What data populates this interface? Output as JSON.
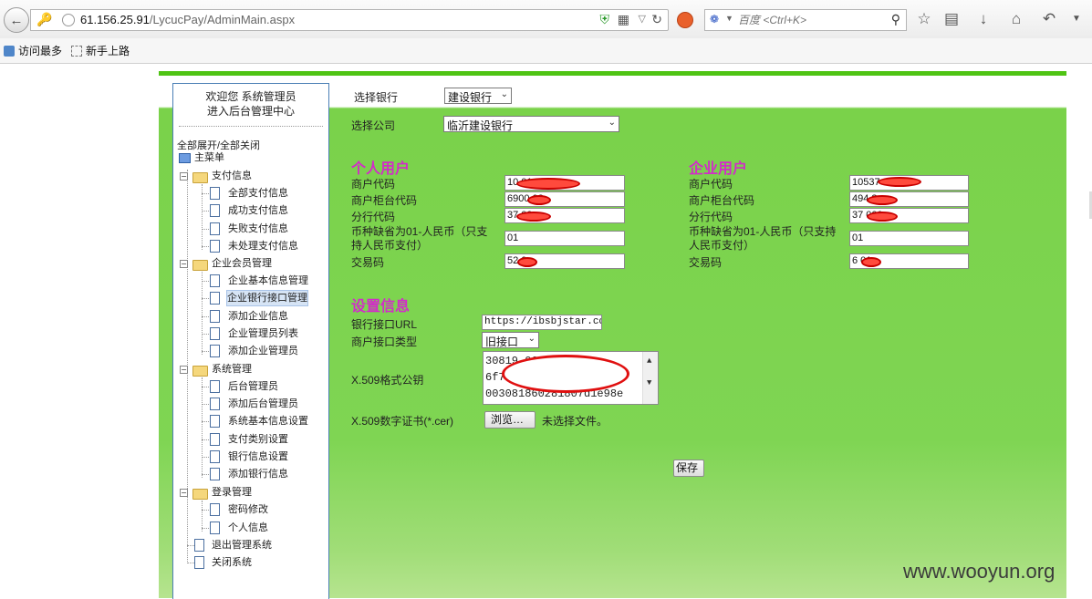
{
  "browser": {
    "url_host": "61.156.25.91",
    "url_path": "/LycucPay/AdminMain.aspx",
    "search_placeholder": "百度 <Ctrl+K>",
    "bookmarks": [
      "访问最多",
      "新手上路"
    ]
  },
  "sidebar": {
    "welcome_line1": "欢迎您  系统管理员",
    "welcome_line2": "进入后台管理中心",
    "toggle_all": "全部展开/全部关闭",
    "root": "主菜单",
    "groups": [
      {
        "label": "支付信息",
        "items": [
          "全部支付信息",
          "成功支付信息",
          "失败支付信息",
          "未处理支付信息"
        ]
      },
      {
        "label": "企业会员管理",
        "items": [
          "企业基本信息管理",
          "企业银行接口管理",
          "添加企业信息",
          "企业管理员列表",
          "添加企业管理员"
        ]
      },
      {
        "label": "系统管理",
        "items": [
          "后台管理员",
          "添加后台管理员",
          "系统基本信息设置",
          "支付类别设置",
          "银行信息设置",
          "添加银行信息"
        ]
      },
      {
        "label": "登录管理",
        "items": [
          "密码修改",
          "个人信息"
        ]
      }
    ],
    "root_items": [
      "退出管理系统",
      "关闭系统"
    ],
    "selected_item": "企业银行接口管理"
  },
  "form": {
    "bank_label": "选择银行",
    "bank_value": "建设银行",
    "company_label": "选择公司",
    "company_value": "临沂建设银行",
    "personal": {
      "title": "个人用户",
      "merchant_code_label": "商户代码",
      "merchant_code_value": "10           01",
      "counter_code_label": "商户柜台代码",
      "counter_code_value": "6900    08",
      "branch_code_label": "分行代码",
      "branch_code_value": "37        00",
      "currency_label_1": "币种缺省为01-人民币（只支",
      "currency_label_2": "持人民币支付）",
      "currency_value": "01",
      "trade_code_label": "交易码",
      "trade_code_value": "52     0"
    },
    "enterprise": {
      "title": "企业用户",
      "merchant_code_label": "商户代码",
      "merchant_code_value": "10537        001",
      "counter_code_label": "商户柜台代码",
      "counter_code_value": "494      8",
      "branch_code_label": "分行代码",
      "branch_code_value": "37       000",
      "currency_label_1": "币种缺省为01-人民币（只支持",
      "currency_label_2": "人民币支付）",
      "currency_value": "01",
      "trade_code_label": "交易码",
      "trade_code_value": "6    01"
    },
    "settings": {
      "title": "设置信息",
      "url_label": "银行接口URL",
      "url_value": "https://ibsbjstar.ccb.",
      "type_label": "商户接口类型",
      "type_value": "旧接口",
      "pubkey_label": "X.509格式公钥",
      "pubkey_line1": "30819          06488",
      "pubkey_line2": "6f7               3a",
      "pubkey_line3": "003081860281807d1e98e",
      "cert_label": "X.509数字证书(*.cer)",
      "browse_label": "浏览…",
      "no_file": "未选择文件。"
    },
    "save_label": "保存"
  },
  "watermark": "www.wooyun.org"
}
